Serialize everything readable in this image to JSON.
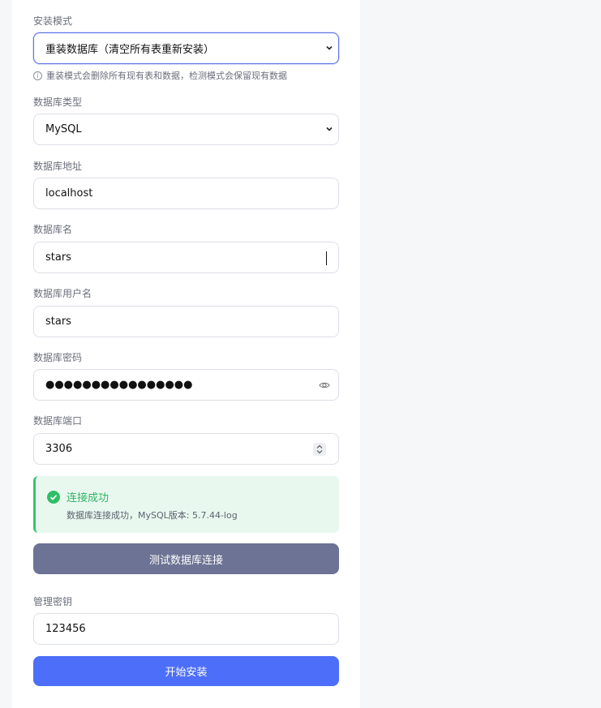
{
  "form": {
    "mode": {
      "label": "安装模式",
      "value": "重装数据库（清空所有表重新安装）",
      "hint": "重装模式会删除所有现有表和数据，检测模式会保留现有数据"
    },
    "db_type": {
      "label": "数据库类型",
      "value": "MySQL"
    },
    "db_host": {
      "label": "数据库地址",
      "value": "localhost"
    },
    "db_name": {
      "label": "数据库名",
      "value": "stars"
    },
    "db_user": {
      "label": "数据库用户名",
      "value": "stars"
    },
    "db_pass": {
      "label": "数据库密码",
      "value": "●●●●●●●●●●●●●●●●"
    },
    "db_port": {
      "label": "数据库端口",
      "value": "3306"
    },
    "admin_key": {
      "label": "管理密钥",
      "value": "123456"
    }
  },
  "status": {
    "title": "连接成功",
    "message": "数据库连接成功，MySQL版本: 5.7.44-log"
  },
  "buttons": {
    "test": "测试数据库连接",
    "install": "开始安装"
  },
  "colors": {
    "primary": "#4d6ef8",
    "secondary": "#6c7394",
    "success": "#3ac46e"
  }
}
